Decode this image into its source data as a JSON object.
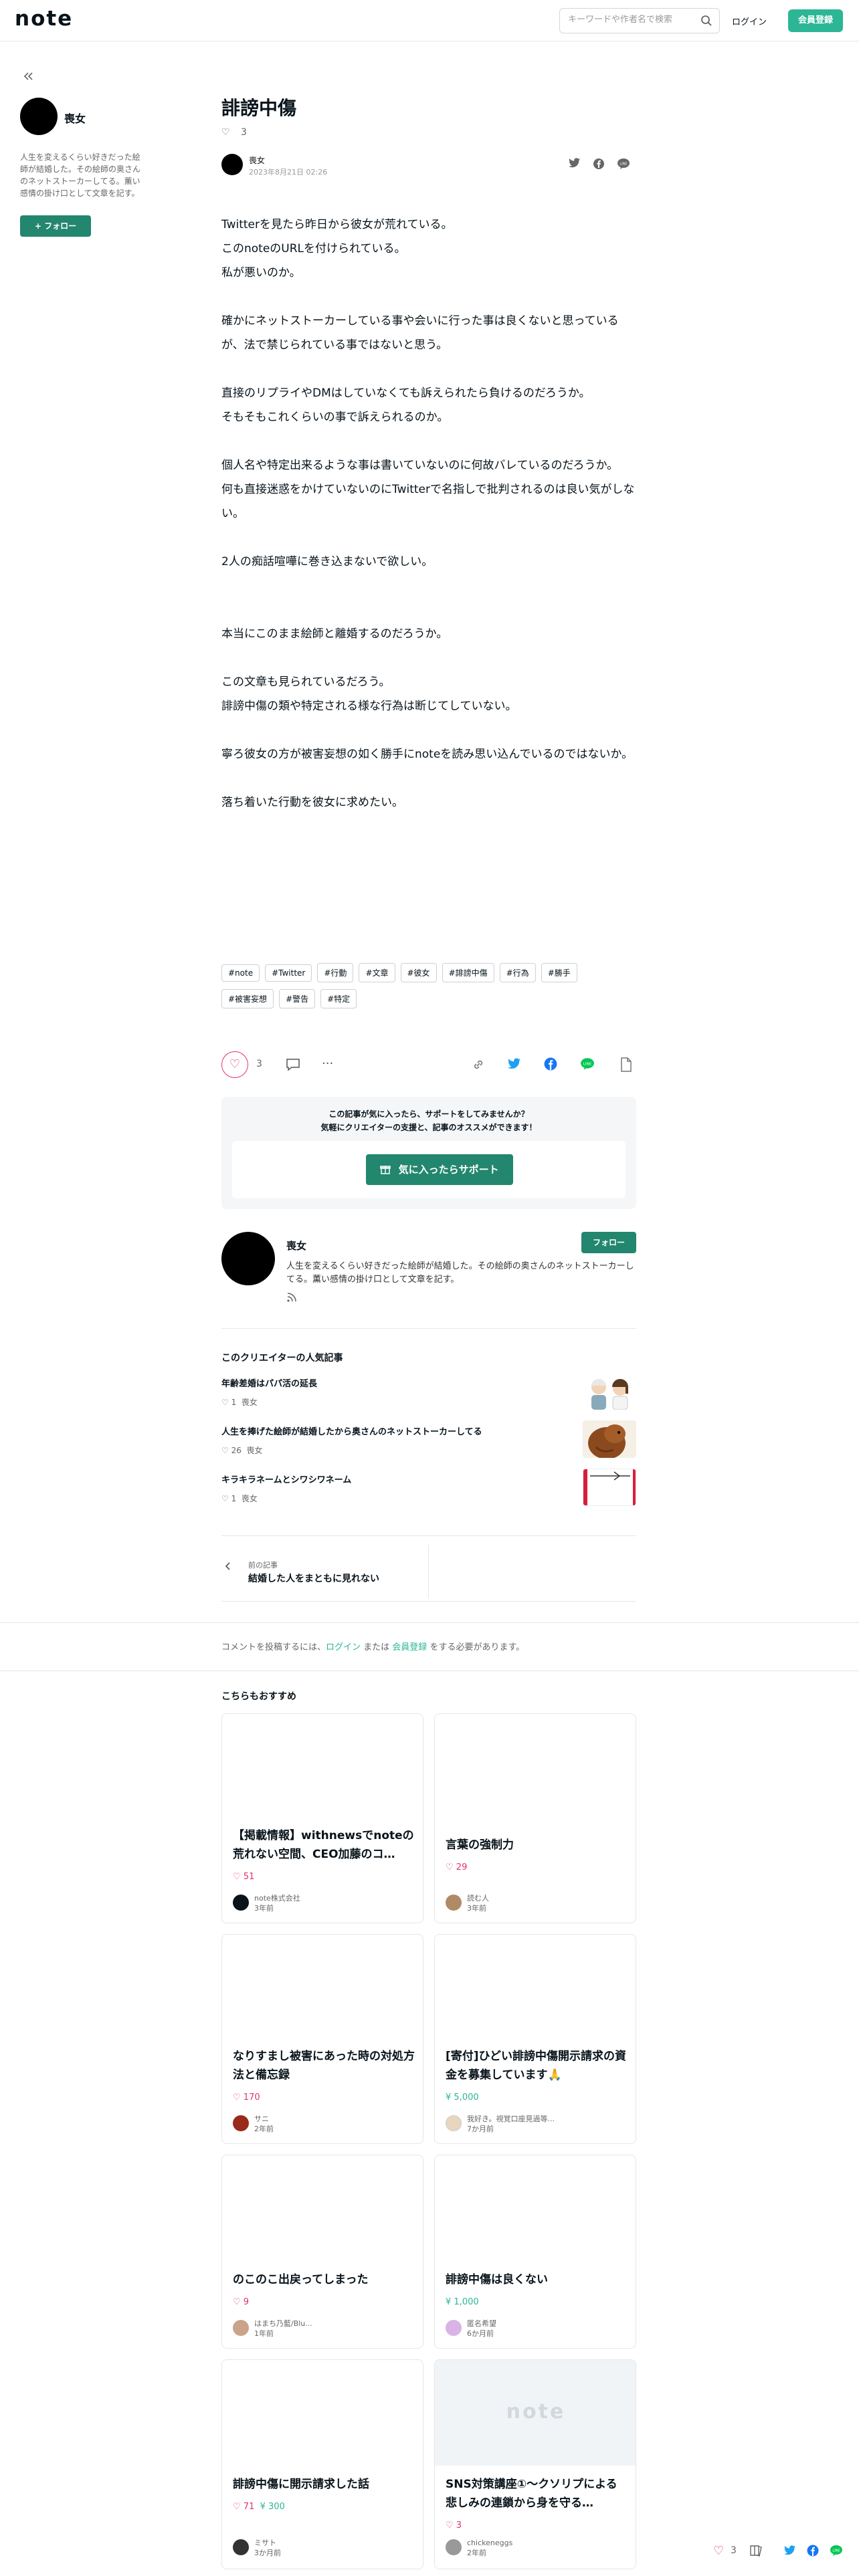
{
  "header": {
    "logo": "note",
    "search_placeholder": "キーワードや作者名で検索",
    "login_label": "ログイン",
    "signup_label": "会員登録"
  },
  "sidebar": {
    "author_name": "喪女",
    "bio": "人生を変えるくらい好きだった絵師が結婚した。その絵師の奥さんのネットストーカーしてる。薫い感情の掛け口として文章を記す。",
    "follow_label": "+ フォロー"
  },
  "article": {
    "title": "誹謗中傷",
    "like_count": "3",
    "author": "喪女",
    "date": "2023年8月21日 02:26",
    "paragraphs": [
      "Twitterを見たら昨日から彼女が荒れている。",
      "このnoteのURLを付けられている。",
      "私が悪いのか。",
      "",
      "確かにネットストーカーしている事や会いに行った事は良くないと思っているが、法で禁じられている事ではないと思う。",
      "",
      "直接のリプライやDMはしていなくても訴えられたら負けるのだろうか。",
      "そもそもこれくらいの事で訴えられるのか。",
      "",
      "個人名や特定出来るような事は書いていないのに何故バレているのだろうか。",
      "何も直接迷惑をかけていないのにTwitterで名指しで批判されるのは良い気がしない。",
      "",
      "2人の痴話喧嘩に巻き込まないで欲しい。",
      "",
      "",
      "本当にこのまま絵師と離婚するのだろうか。",
      "",
      "この文章も見られているだろう。",
      "誹謗中傷の類や特定される様な行為は断じてしていない。",
      "",
      "寧ろ彼女の方が被害妄想の如く勝手にnoteを読み思い込んでいるのではないか。",
      "",
      "落ち着いた行動を彼女に求めたい。"
    ],
    "tags": [
      "#note",
      "#Twitter",
      "#行動",
      "#文章",
      "#彼女",
      "#誹謗中傷",
      "#行為",
      "#勝手",
      "#被害妄想",
      "#警告",
      "#特定"
    ]
  },
  "support": {
    "line1": "この記事が気に入ったら、サポートをしてみませんか？",
    "line2": "気軽にクリエイターの支援と、記事のオススメができます！",
    "button": "気に入ったらサポート"
  },
  "creator": {
    "name": "喪女",
    "follow_label": "フォロー",
    "bio": "人生を変えるくらい好きだった絵師が結婚した。その絵師の奥さんのネットストーカーしてる。薫い感情の掛け口として文章を記す。"
  },
  "popular": {
    "heading": "このクリエイターの人気記事",
    "items": [
      {
        "title": "年齢差婚はパパ活の延長",
        "likes": "1",
        "author": "喪女"
      },
      {
        "title": "人生を捧げた絵師が結婚したから奥さんのネットストーカーしてる",
        "likes": "26",
        "author": "喪女"
      },
      {
        "title": "キラキラネームとシワシワネーム",
        "likes": "1",
        "author": "喪女"
      }
    ]
  },
  "prev_article": {
    "label": "前の記事",
    "title": "結婚した人をまともに見れない"
  },
  "comment": {
    "prefix": "コメントを投稿するには、",
    "login": "ログイン",
    "or": " または ",
    "signup": "会員登録",
    "suffix": " をする必要があります。"
  },
  "recommend": {
    "heading": "こちらもおすすめ",
    "cards": [
      {
        "title": "【掲載情報】withnewsでnoteの荒れない空間、CEO加藤のコ…",
        "likes": "51",
        "support": "",
        "author": "note株式会社",
        "age": "3年前"
      },
      {
        "title": "言葉の強制力",
        "likes": "29",
        "support": "",
        "author": "読む人",
        "age": "3年前"
      },
      {
        "title": "なりすまし被害にあった時の対処方法と備忘録",
        "likes": "170",
        "support": "",
        "author": "サニ",
        "age": "2年前"
      },
      {
        "title": "[寄付]ひどい誹謗中傷開示請求の資金を募集しています🙏",
        "likes": "",
        "support": "5,000",
        "author": "我好き。視覚口座見過等...",
        "age": "7か月前"
      },
      {
        "title": "のこのこ出戻ってしまった",
        "likes": "9",
        "support": "",
        "author": "はまち乃藍/Blu...",
        "age": "1年前"
      },
      {
        "title": "誹謗中傷は良くない",
        "likes": "",
        "support": "1,000",
        "author": "匿名希望",
        "age": "6か月前"
      },
      {
        "title": "誹謗中傷に開示請求した話",
        "likes": "71",
        "support": "300",
        "author": "ミサト",
        "age": "3か月前"
      },
      {
        "title": "SNS対策講座①～クソリプによる悲しみの連鎖から身を守る…",
        "likes": "3",
        "support": "",
        "author": "chickeneggs",
        "age": "2年前"
      }
    ],
    "placeholder_logo": "note"
  },
  "floating": {
    "like_count": "3"
  },
  "colors": {
    "brand": "#2cb696",
    "brand_dark": "#23866f",
    "like": "#e2316b",
    "twitter": "#1da1f2",
    "facebook": "#1877f2",
    "line": "#06c755"
  }
}
